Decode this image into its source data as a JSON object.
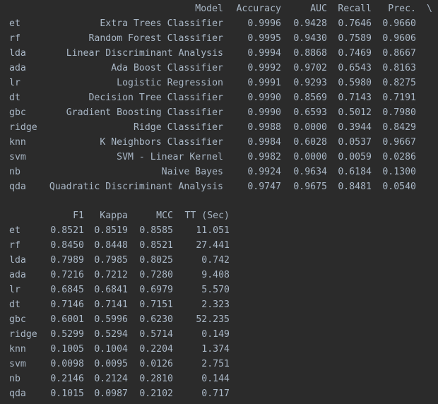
{
  "table1": {
    "headers": [
      "Model",
      "Accuracy",
      "AUC",
      "Recall",
      "Prec."
    ],
    "continuation": "\\",
    "rows": [
      {
        "id": "et",
        "model": "Extra Trees Classifier",
        "values": [
          "0.9996",
          "0.9428",
          "0.7646",
          "0.9660"
        ]
      },
      {
        "id": "rf",
        "model": "Random Forest Classifier",
        "values": [
          "0.9995",
          "0.9430",
          "0.7589",
          "0.9606"
        ]
      },
      {
        "id": "lda",
        "model": "Linear Discriminant Analysis",
        "values": [
          "0.9994",
          "0.8868",
          "0.7469",
          "0.8667"
        ]
      },
      {
        "id": "ada",
        "model": "Ada Boost Classifier",
        "values": [
          "0.9992",
          "0.9702",
          "0.6543",
          "0.8163"
        ]
      },
      {
        "id": "lr",
        "model": "Logistic Regression",
        "values": [
          "0.9991",
          "0.9293",
          "0.5980",
          "0.8275"
        ]
      },
      {
        "id": "dt",
        "model": "Decision Tree Classifier",
        "values": [
          "0.9990",
          "0.8569",
          "0.7143",
          "0.7191"
        ]
      },
      {
        "id": "gbc",
        "model": "Gradient Boosting Classifier",
        "values": [
          "0.9990",
          "0.6593",
          "0.5012",
          "0.7980"
        ]
      },
      {
        "id": "ridge",
        "model": "Ridge Classifier",
        "values": [
          "0.9988",
          "0.0000",
          "0.3944",
          "0.8429"
        ]
      },
      {
        "id": "knn",
        "model": "K Neighbors Classifier",
        "values": [
          "0.9984",
          "0.6028",
          "0.0537",
          "0.9667"
        ]
      },
      {
        "id": "svm",
        "model": "SVM - Linear Kernel",
        "values": [
          "0.9982",
          "0.0000",
          "0.0059",
          "0.0286"
        ]
      },
      {
        "id": "nb",
        "model": "Naive Bayes",
        "values": [
          "0.9924",
          "0.9634",
          "0.6184",
          "0.1300"
        ]
      },
      {
        "id": "qda",
        "model": "Quadratic Discriminant Analysis",
        "values": [
          "0.9747",
          "0.9675",
          "0.8481",
          "0.0540"
        ]
      }
    ]
  },
  "table2": {
    "headers": [
      "F1",
      "Kappa",
      "MCC",
      "TT (Sec)"
    ],
    "rows": [
      {
        "id": "et",
        "values": [
          "0.8521",
          "0.8519",
          "0.8585",
          "11.051"
        ]
      },
      {
        "id": "rf",
        "values": [
          "0.8450",
          "0.8448",
          "0.8521",
          "27.441"
        ]
      },
      {
        "id": "lda",
        "values": [
          "0.7989",
          "0.7985",
          "0.8025",
          "0.742"
        ]
      },
      {
        "id": "ada",
        "values": [
          "0.7216",
          "0.7212",
          "0.7280",
          "9.408"
        ]
      },
      {
        "id": "lr",
        "values": [
          "0.6845",
          "0.6841",
          "0.6979",
          "5.570"
        ]
      },
      {
        "id": "dt",
        "values": [
          "0.7146",
          "0.7141",
          "0.7151",
          "2.323"
        ]
      },
      {
        "id": "gbc",
        "values": [
          "0.6001",
          "0.5996",
          "0.6230",
          "52.235"
        ]
      },
      {
        "id": "ridge",
        "values": [
          "0.5299",
          "0.5294",
          "0.5714",
          "0.149"
        ]
      },
      {
        "id": "knn",
        "values": [
          "0.1005",
          "0.1004",
          "0.2204",
          "1.374"
        ]
      },
      {
        "id": "svm",
        "values": [
          "0.0098",
          "0.0095",
          "0.0126",
          "2.751"
        ]
      },
      {
        "id": "nb",
        "values": [
          "0.2146",
          "0.2124",
          "0.2810",
          "0.144"
        ]
      },
      {
        "id": "qda",
        "values": [
          "0.1015",
          "0.0987",
          "0.2102",
          "0.717"
        ]
      }
    ]
  }
}
